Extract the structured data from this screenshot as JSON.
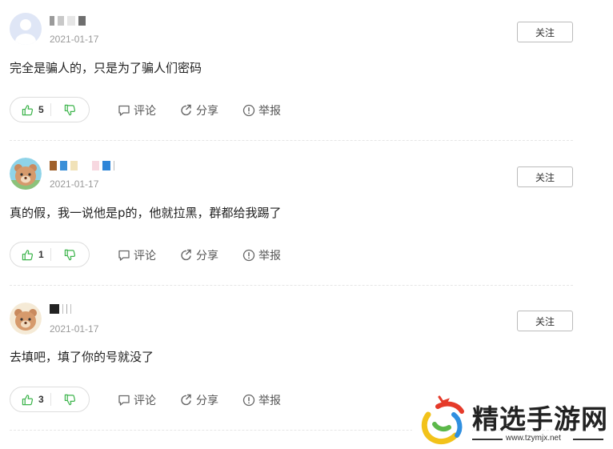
{
  "comments": [
    {
      "username_colors": [
        "#9a9a9a",
        "#c8c8c8",
        "#6e6e6e",
        "#b5b5b5"
      ],
      "avatar": "default-user-avatar",
      "date": "2021-01-17",
      "follow_label": "关注",
      "text": "完全是骗人的，只是为了骗人们密码",
      "likes": "5",
      "comment_label": "评论",
      "share_label": "分享",
      "report_label": "举报"
    },
    {
      "username_colors": [
        "#a0602a",
        "#3a8fd8",
        "#f1e2b8",
        "#f7d8e0",
        "#2f86d8"
      ],
      "avatar": "bear-avatar",
      "date": "2021-01-17",
      "follow_label": "关注",
      "text": "真的假，我一说他是p的，他就拉黑，群都给我踢了",
      "likes": "1",
      "comment_label": "评论",
      "share_label": "分享",
      "report_label": "举报"
    },
    {
      "username_colors": [
        "#222222",
        "#bdbdbd",
        "#a8a8a8"
      ],
      "avatar": "bear-avatar",
      "date": "2021-01-17",
      "follow_label": "关注",
      "text": "去填吧，填了你的号就没了",
      "likes": "3",
      "comment_label": "评论",
      "share_label": "分享",
      "report_label": "举报"
    }
  ],
  "watermark": {
    "title": "精选手游网",
    "url": "www.tzymjx.net"
  },
  "colors": {
    "like_green": "#3cb44b",
    "text": "#222222",
    "muted": "#999999"
  }
}
